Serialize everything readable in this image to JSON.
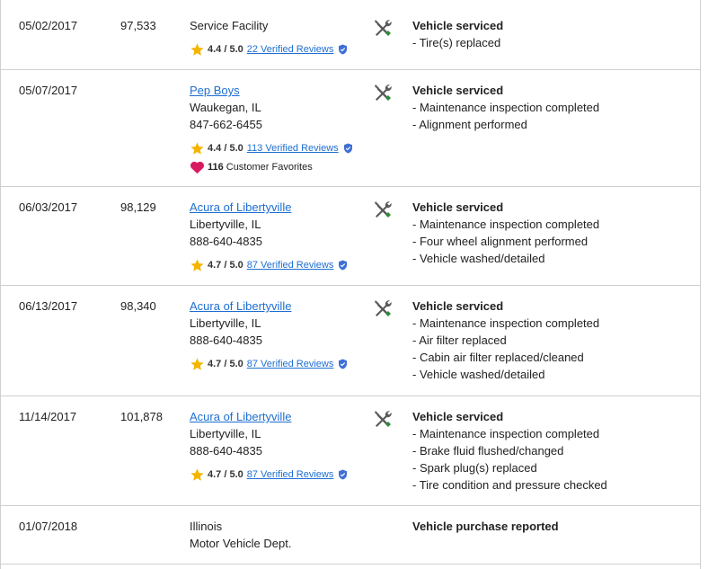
{
  "rows": [
    {
      "date": "05/02/2017",
      "mileage": "97,533",
      "source": {
        "name": "Service Facility",
        "is_link": false,
        "location": "",
        "phone": ""
      },
      "rating": {
        "score": "4.4 / 5.0",
        "reviews": "22 Verified Reviews"
      },
      "details": {
        "title": "Vehicle serviced",
        "items": [
          "- Tire(s) replaced"
        ]
      }
    },
    {
      "date": "05/07/2017",
      "mileage": "",
      "source": {
        "name": "Pep Boys",
        "is_link": true,
        "location": "Waukegan, IL",
        "phone": "847-662-6455"
      },
      "rating": {
        "score": "4.4 / 5.0",
        "reviews": "113 Verified Reviews"
      },
      "favorites": {
        "count": "116",
        "label": "Customer Favorites"
      },
      "details": {
        "title": "Vehicle serviced",
        "items": [
          "- Maintenance inspection completed",
          "- Alignment performed"
        ]
      }
    },
    {
      "date": "06/03/2017",
      "mileage": "98,129",
      "source": {
        "name": "Acura of Libertyville",
        "is_link": true,
        "location": "Libertyville, IL",
        "phone": "888-640-4835"
      },
      "rating": {
        "score": "4.7 / 5.0",
        "reviews": "87 Verified Reviews"
      },
      "details": {
        "title": "Vehicle serviced",
        "items": [
          "- Maintenance inspection completed",
          "- Four wheel alignment performed",
          "- Vehicle washed/detailed"
        ]
      }
    },
    {
      "date": "06/13/2017",
      "mileage": "98,340",
      "source": {
        "name": "Acura of Libertyville",
        "is_link": true,
        "location": "Libertyville, IL",
        "phone": "888-640-4835"
      },
      "rating": {
        "score": "4.7 / 5.0",
        "reviews": "87 Verified Reviews"
      },
      "details": {
        "title": "Vehicle serviced",
        "items": [
          "- Maintenance inspection completed",
          "- Air filter replaced",
          "- Cabin air filter replaced/cleaned",
          "- Vehicle washed/detailed"
        ]
      }
    },
    {
      "date": "11/14/2017",
      "mileage": "101,878",
      "source": {
        "name": "Acura of Libertyville",
        "is_link": true,
        "location": "Libertyville, IL",
        "phone": "888-640-4835"
      },
      "rating": {
        "score": "4.7 / 5.0",
        "reviews": "87 Verified Reviews"
      },
      "details": {
        "title": "Vehicle serviced",
        "items": [
          "- Maintenance inspection completed",
          "- Brake fluid flushed/changed",
          "- Spark plug(s) replaced",
          "- Tire condition and pressure checked"
        ]
      }
    },
    {
      "date": "01/07/2018",
      "mileage": "",
      "source": {
        "name": "Illinois",
        "is_link": false,
        "location": "Motor Vehicle Dept.",
        "phone": ""
      },
      "details": {
        "title": "Vehicle purchase reported",
        "items": []
      }
    }
  ],
  "colors": {
    "link": "#1e6fd1",
    "star": "#f5b400",
    "verified": "#3d6fd6",
    "heart": "#d81b60",
    "tool": "#5a5a5a",
    "tool_accent": "#2e8b3d"
  },
  "icons": {
    "service": "wrench-screwdriver-icon",
    "star": "star-icon",
    "verified": "verified-shield-icon",
    "heart": "heart-icon"
  }
}
